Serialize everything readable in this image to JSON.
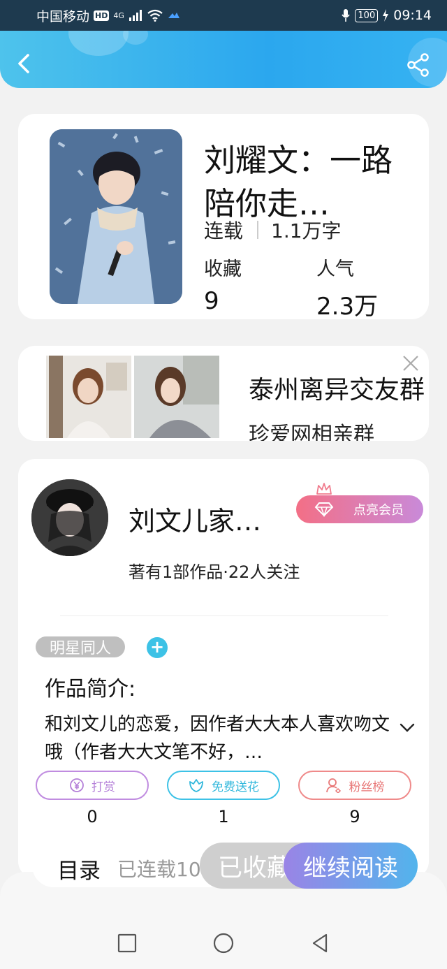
{
  "status_bar": {
    "carrier": "中国移动",
    "hd": "HD",
    "network": "4G",
    "battery": "100",
    "time": "09:14"
  },
  "book": {
    "title": "刘耀文：一路陪你走…",
    "status": "连载",
    "word_count": "1.1万字",
    "favorites_label": "收藏",
    "favorites_value": "9",
    "popularity_label": "人气",
    "popularity_value": "2.3万"
  },
  "ad": {
    "title": "泰州离异交友群",
    "subtitle": "珍爱网相亲群"
  },
  "author": {
    "name": "刘文儿家…",
    "stats": "著有1部作品·22人关注",
    "vip_label": "点亮会员"
  },
  "tags": [
    "明星同人"
  ],
  "intro": {
    "label": "作品简介:",
    "text": "和刘文儿的恋爱，因作者大大本人喜欢吻文哦（作者大大文笔不好，…"
  },
  "actions": [
    {
      "label": "打赏",
      "count": "0"
    },
    {
      "label": "免费送花",
      "count": "1"
    },
    {
      "label": "粉丝榜",
      "count": "9"
    }
  ],
  "bottom_bar": {
    "toc_label": "目录",
    "toc_progress": "已连载10",
    "collect_label": "已收藏",
    "read_label": "继续阅读"
  },
  "colors": {
    "header_blue": "#2ba7ee",
    "reward_purple": "#c08ce0",
    "flower_cyan": "#3dc2e6",
    "fans_pink": "#ef8a8a",
    "vip_pink": "#f36f86"
  }
}
